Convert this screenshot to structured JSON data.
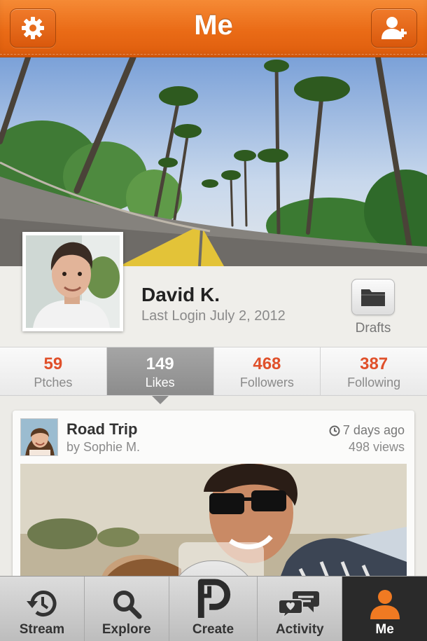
{
  "header": {
    "title": "Me",
    "settings_icon": "gear-icon",
    "add_friend_icon": "add-user-icon"
  },
  "profile": {
    "name": "David K.",
    "last_login": "Last Login July 2, 2012",
    "drafts_label": "Drafts",
    "drafts_icon": "folder-icon"
  },
  "stats": [
    {
      "value": "59",
      "label": "Ptches"
    },
    {
      "value": "149",
      "label": "Likes",
      "active": true
    },
    {
      "value": "468",
      "label": "Followers"
    },
    {
      "value": "387",
      "label": "Following"
    }
  ],
  "feed": {
    "title": "Road Trip",
    "author": "by Sophie M.",
    "time": "7 days ago",
    "views": "498 views",
    "time_icon": "clock-icon",
    "play_icon": "play-icon"
  },
  "tabs": [
    {
      "label": "Stream",
      "icon": "history-icon"
    },
    {
      "label": "Explore",
      "icon": "search-icon"
    },
    {
      "label": "Create",
      "icon": "create-logo-icon"
    },
    {
      "label": "Activity",
      "icon": "chat-bubbles-icon"
    },
    {
      "label": "Me",
      "icon": "person-icon",
      "active": true
    }
  ],
  "colors": {
    "brand_orange": "#e8661a",
    "stat_number": "#e0502a",
    "active_tab": "#2a2a2a"
  }
}
